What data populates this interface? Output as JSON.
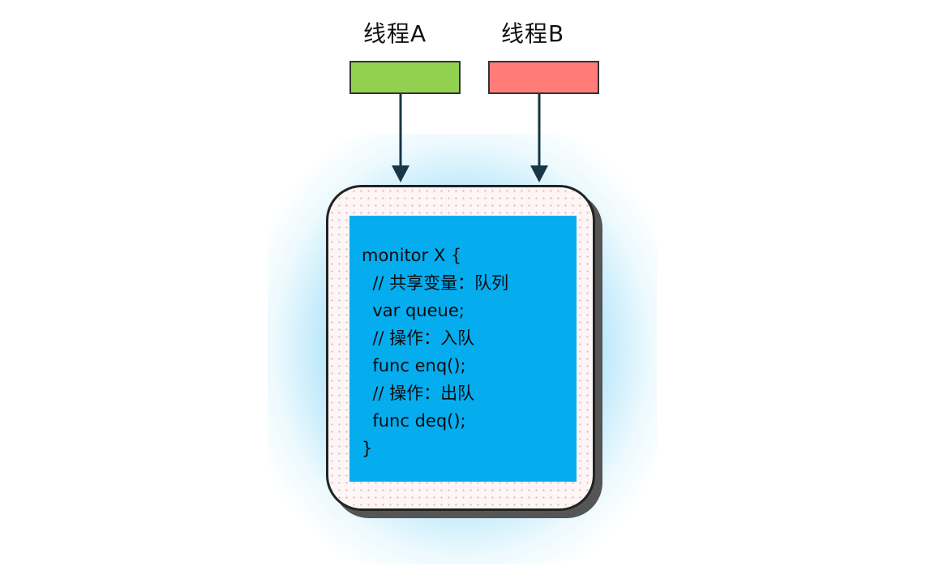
{
  "threads": [
    {
      "label": "线程A",
      "color": "#92d050"
    },
    {
      "label": "线程B",
      "color": "#ff7c78"
    }
  ],
  "monitor": {
    "code_lines": [
      "monitor X {",
      "  // 共享变量：队列",
      "  var queue;",
      "  // 操作：入队",
      "  func enq();",
      "  // 操作：出队",
      "  func deq();",
      "}"
    ]
  }
}
